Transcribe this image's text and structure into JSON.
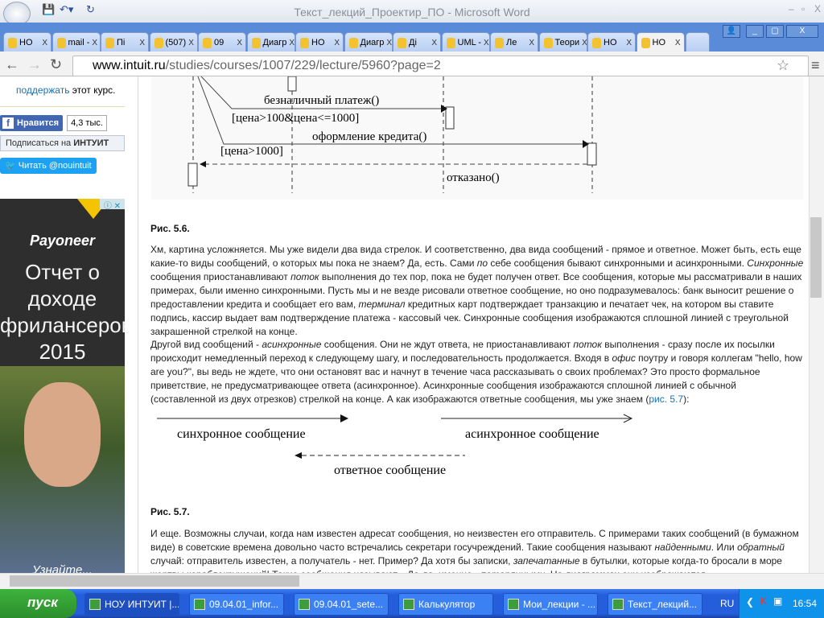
{
  "word": {
    "title": "Текст_лекций_Проектир_ПО - Microsoft Word"
  },
  "tabs": [
    {
      "label": "НО"
    },
    {
      "label": "mail -"
    },
    {
      "label": "Пі"
    },
    {
      "label": "(507)"
    },
    {
      "label": "09"
    },
    {
      "label": "Диагр"
    },
    {
      "label": "НО"
    },
    {
      "label": "Диагр"
    },
    {
      "label": "Ді"
    },
    {
      "label": "UML -"
    },
    {
      "label": "Ле"
    },
    {
      "label": "Теори"
    },
    {
      "label": "НО"
    },
    {
      "label": "НО"
    }
  ],
  "address": {
    "host": "www.intuit.ru",
    "path": "/studies/courses/1007/229/lecture/5960?page=2"
  },
  "sidebar": {
    "support_link": "поддержать",
    "support_text": " этот курс.",
    "like": "Нравится",
    "like_count": "4,3 тыс.",
    "subscribe": "Подписаться на ",
    "subscribe_bold": "ИНТУИТ",
    "twitter": "Читать @nouintuit"
  },
  "ad": {
    "brand": "Payoneer",
    "line1": "Отчет о",
    "line2": "доходе",
    "line3": "фрилансеров",
    "line4": "2015",
    "cta": "Узнайте..."
  },
  "figure56": {
    "msg1": "безналичный платеж()",
    "guard1": "[цена>100&цена<=1000]",
    "msg2": "оформление кредита()",
    "guard2": "[цена>1000]",
    "msg3": "отказано()",
    "caption": "Рис. 5.6."
  },
  "para1": [
    "Хм, картина усложняется. Мы уже видели два вида стрелок. И соответственно, два вида сообщений - прямое и ответное. Может быть, есть еще какие-то виды сообщений, о которых мы пока не знаем? Да, есть. Сами ",
    "по",
    " себе сообщения бывают синхронными и асинхронными. ",
    "Синхронные",
    " сообщения приостанавливают ",
    "поток",
    " выполнения до тех пор, пока не будет получен ответ. Все сообщения, которые мы рассматривали в наших примерах, были именно синхронными. Пусть мы и не везде рисовали ответное сообщение, но оно подразумевалось: банк выносит решение о предоставлении кредита и сообщает его вам, ",
    "терминал",
    " кредитных карт подтверждает транзакцию и печатает чек, на котором вы ставите подпись, кассир выдает вам подтверждение платежа - кассовый чек. Синхронные сообщения изображаются сплошной линией с треугольной закрашенной стрелкой на конце."
  ],
  "para2": [
    "Другой вид сообщений - ",
    "асинхронные",
    " сообщения. Они не ждут ответа, не приостанавливают ",
    "поток",
    " выполнения - сразу после их посылки происходит немедленный переход к следующему шагу, и последовательность продолжается. Входя в ",
    "офис",
    " поутру и говоря коллегам \"hello, how are you?\", вы ведь не ждете, что они остановят вас и начнут в течение часа рассказывать о своих проблемах? Это просто формальное приветствие, не предусматривающее ответа (асинхронное). Асинхронные сообщения изображаются сплошной линией с обычной (составленной из двух отрезков) стрелкой на конце. А как изображаются ответные сообщения, мы уже знаем (",
    "рис. 5.7",
    "):"
  ],
  "figure57": {
    "sync": "синхронное сообщение",
    "async": "асинхронное сообщение",
    "reply": "ответное сообщение",
    "caption": "Рис. 5.7."
  },
  "para3": [
    "И еще. Возможны случаи, когда нам известен адресат сообщения, но неизвестен его отправитель. С примерами таких сообщений (в бумажном виде) в советские времена довольно часто встречались секретари госучреждений. Такие сообщения называют ",
    "найденными",
    ". Или ",
    "обратный",
    " случай: отправитель известен, а получатель - нет. Пример? Да хотя бы записки, ",
    "запечатанные",
    " в бутылки, которые когда-то бросали в море жертвы кораблекрушений! Такие сообщения называют... Да-да, именно - ",
    "потерянными",
    ". На диаграммах они изображаются"
  ],
  "taskbar": {
    "start": "пуск",
    "tasks": [
      {
        "label": "НОУ ИНТУИТ |..."
      },
      {
        "label": "09.04.01_infor..."
      },
      {
        "label": "09.04.01_sete..."
      },
      {
        "label": "Калькулятор"
      },
      {
        "label": "Мои_лекции - ..."
      },
      {
        "label": "Текст_лекций..."
      }
    ],
    "lang": "RU",
    "time": "16:54"
  }
}
